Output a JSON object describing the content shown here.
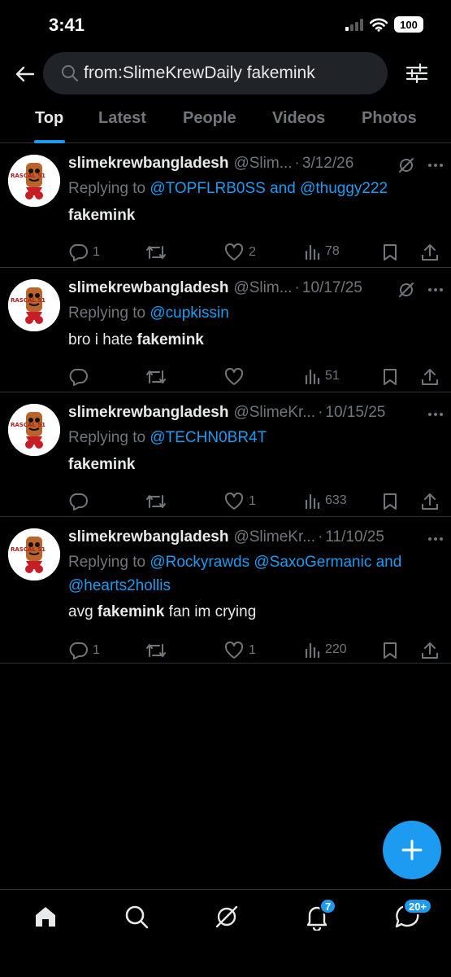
{
  "status_bar": {
    "time": "3:41",
    "battery": "100"
  },
  "search": {
    "query": "from:SlimeKrewDaily fakemink"
  },
  "tabs": [
    {
      "label": "Top",
      "active": true
    },
    {
      "label": "Latest",
      "active": false
    },
    {
      "label": "People",
      "active": false
    },
    {
      "label": "Videos",
      "active": false
    },
    {
      "label": "Photos",
      "active": false
    }
  ],
  "tweets": [
    {
      "name": "slimekrewbangladesh",
      "handle": "@Slim...",
      "date": "3/12/26",
      "replying_prefix": "Replying to",
      "mentions_line1": "@TOPFLRB0SS and @thuggy222",
      "mentions_line2": "",
      "text_pre": "",
      "text_bold": "fakemink",
      "text_post": "",
      "replies": "1",
      "retweets": "",
      "likes": "2",
      "views": "78",
      "has_grok": true
    },
    {
      "name": "slimekrewbangladesh",
      "handle": "@Slim...",
      "date": "10/17/25",
      "replying_prefix": "Replying to",
      "mentions_line1": "@cupkissin",
      "mentions_line2": "",
      "text_pre": "bro i hate ",
      "text_bold": "fakemink",
      "text_post": "",
      "replies": "",
      "retweets": "",
      "likes": "",
      "views": "51",
      "has_grok": true
    },
    {
      "name": "slimekrewbangladesh",
      "handle": "@SlimeKr...",
      "date": "10/15/25",
      "replying_prefix": "Replying to",
      "mentions_line1": "@TECHN0BR4T",
      "mentions_line2": "",
      "text_pre": "",
      "text_bold": "fakemink",
      "text_post": "",
      "replies": "",
      "retweets": "",
      "likes": "1",
      "views": "633",
      "has_grok": false
    },
    {
      "name": "slimekrewbangladesh",
      "handle": "@SlimeKr...",
      "date": "11/10/25",
      "replying_prefix": "Replying to",
      "mentions_line1": "@Rockyrawds @SaxoGermanic and",
      "mentions_line2": "@hearts2hollis",
      "text_pre": "avg ",
      "text_bold": "fakemink",
      "text_post": " fan im crying",
      "replies": "1",
      "retweets": "",
      "likes": "1",
      "views": "220",
      "has_grok": false
    }
  ],
  "avatar_text": "RASCAL 51",
  "bottom_nav": {
    "notifications_badge": "7",
    "messages_badge": "20+"
  },
  "colors": {
    "accent": "#1d9bf0",
    "background": "#000000",
    "muted": "#71767b"
  }
}
